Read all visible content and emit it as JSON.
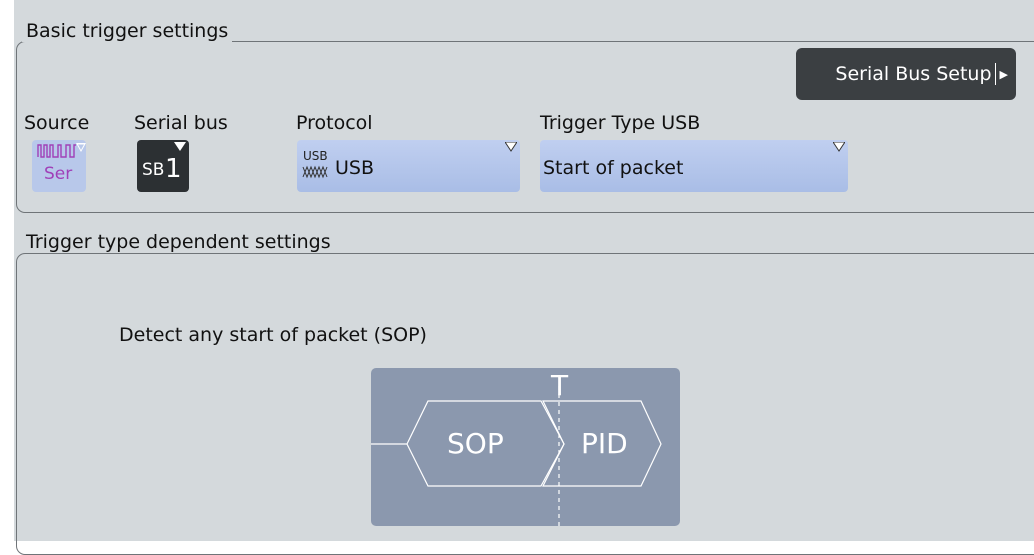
{
  "basic": {
    "title": "Basic trigger settings",
    "serial_bus_setup_label": "Serial Bus Setup",
    "source": {
      "label": "Source",
      "icon_text": "Ser"
    },
    "serial_bus": {
      "label": "Serial bus",
      "icon_prefix": "SB",
      "icon_number": "1"
    },
    "protocol": {
      "label": "Protocol",
      "icon_text": "USB",
      "value": "USB"
    },
    "trigger_type": {
      "label": "Trigger Type USB",
      "value": "Start of packet"
    }
  },
  "dependent": {
    "title": "Trigger type dependent settings",
    "description": "Detect any start of packet (SOP)",
    "diagram": {
      "trigger_marker": "T",
      "left_label": "SOP",
      "right_label": "PID"
    }
  },
  "colors": {
    "panel_bg": "#d4d9dc",
    "dropdown_bg": "#b5c6ea",
    "button_dark": "#3b3f42",
    "diagram_bg": "#8b98ae"
  }
}
